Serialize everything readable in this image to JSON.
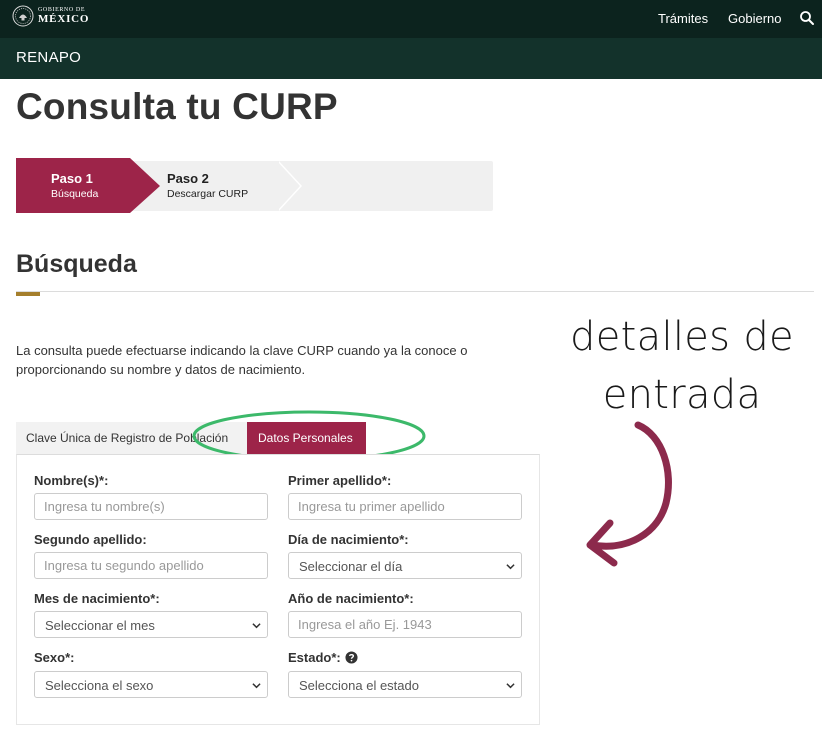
{
  "header": {
    "logo_line1": "GOBIERNO DE",
    "logo_line2": "MÉXICO",
    "nav": [
      "Trámites",
      "Gobierno"
    ],
    "search_icon": "search-icon",
    "brand": "RENAPO"
  },
  "page_title": "Consulta tu CURP",
  "stepper": {
    "steps": [
      {
        "title": "Paso 1",
        "subtitle": "Búsqueda",
        "active": true
      },
      {
        "title": "Paso 2",
        "subtitle": "Descargar CURP",
        "active": false
      }
    ]
  },
  "section_title": "Búsqueda",
  "intro": "La consulta puede efectuarse indicando la clave CURP cuando ya la conoce o proporcionando su nombre y datos de nacimiento.",
  "annotation": {
    "line1": "detalles de",
    "line2": "entrada"
  },
  "tabs": [
    {
      "label": "Clave Única de Registro de Población",
      "active": false
    },
    {
      "label": "Datos Personales",
      "active": true
    }
  ],
  "form": {
    "nombre": {
      "label": "Nombre(s)*:",
      "placeholder": "Ingresa tu nombre(s)"
    },
    "primer_apellido": {
      "label": "Primer apellido*:",
      "placeholder": "Ingresa tu primer apellido"
    },
    "segundo_apellido": {
      "label": "Segundo apellido:",
      "placeholder": "Ingresa tu segundo apellido"
    },
    "dia": {
      "label": "Día de nacimiento*:",
      "value": "Seleccionar el día"
    },
    "mes": {
      "label": "Mes de nacimiento*:",
      "value": "Seleccionar el mes"
    },
    "anio": {
      "label": "Año de nacimiento*:",
      "placeholder": "Ingresa el año Ej. 1943"
    },
    "sexo": {
      "label": "Sexo*:",
      "value": "Selecciona el sexo"
    },
    "estado": {
      "label": "Estado*:",
      "value": "Selecciona el estado"
    }
  },
  "colors": {
    "top_bar": "#0c231e",
    "sub_bar": "#13322b",
    "accent": "#9d2449",
    "gold": "#a57f2c",
    "annotation_oval": "#3cb96a",
    "annotation_arrow": "#8c2a4c"
  }
}
